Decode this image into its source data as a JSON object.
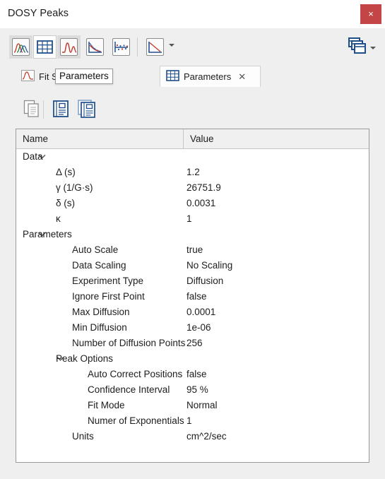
{
  "window": {
    "title": "DOSY Peaks",
    "close_label": "×"
  },
  "toolbar": {
    "buttons": [
      {
        "name": "multi-spectra-icon",
        "tooltip": "Spectra"
      },
      {
        "name": "table-icon",
        "tooltip": "Table"
      },
      {
        "name": "single-spectrum-icon",
        "tooltip": "Fit Spectra"
      },
      {
        "name": "decay-curves-icon",
        "tooltip": "Decay Curves"
      },
      {
        "name": "residuals-icon",
        "tooltip": "Residuals"
      },
      {
        "name": "diffusion-plot-icon",
        "tooltip": "Diffusion Plot"
      }
    ],
    "layout_icon": "stacked-windows-icon"
  },
  "tabs": [
    {
      "label": "Fit Spectra",
      "icon": "single-spectrum-icon",
      "close": "✕",
      "selected": false
    },
    {
      "label": "Parameters",
      "icon": "table-icon",
      "close": "✕",
      "selected": true
    }
  ],
  "tooltip": {
    "text": "Parameters"
  },
  "subtoolbar": {
    "buttons": [
      {
        "name": "copy-icon"
      },
      {
        "name": "report-icon"
      },
      {
        "name": "multi-report-icon"
      }
    ]
  },
  "table": {
    "columns": [
      "Name",
      "Value"
    ],
    "rows": [
      {
        "name": "Data",
        "value": "",
        "level": 0,
        "group": true
      },
      {
        "name": "Δ (s)",
        "value": "1.2",
        "level": 1,
        "group": false
      },
      {
        "name": "γ (1/G·s)",
        "value": "26751.9",
        "level": 1,
        "group": false
      },
      {
        "name": "δ (s)",
        "value": "0.0031",
        "level": 1,
        "group": false
      },
      {
        "name": "κ",
        "value": "1",
        "level": 1,
        "group": false
      },
      {
        "name": "Parameters",
        "value": "",
        "level": 0,
        "group": true
      },
      {
        "name": "Auto Scale",
        "value": "true",
        "level": 2,
        "group": false
      },
      {
        "name": "Data Scaling",
        "value": "No Scaling",
        "level": 2,
        "group": false
      },
      {
        "name": "Experiment Type",
        "value": "Diffusion",
        "level": 2,
        "group": false
      },
      {
        "name": "Ignore First Point",
        "value": "false",
        "level": 2,
        "group": false
      },
      {
        "name": "Max Diffusion",
        "value": "0.0001",
        "level": 2,
        "group": false
      },
      {
        "name": "Min Diffusion",
        "value": "1e-06",
        "level": 2,
        "group": false
      },
      {
        "name": "Number of Diffusion Points",
        "value": "256",
        "level": 2,
        "group": false
      },
      {
        "name": "Peak Options",
        "value": "",
        "level": 1,
        "group": true
      },
      {
        "name": "Auto Correct Positions",
        "value": "false",
        "level": 3,
        "group": false
      },
      {
        "name": "Confidence Interval",
        "value": "95 %",
        "level": 3,
        "group": false
      },
      {
        "name": "Fit Mode",
        "value": "Normal",
        "level": 3,
        "group": false
      },
      {
        "name": "Numer of Exponentials",
        "value": "1",
        "level": 3,
        "group": false
      },
      {
        "name": "Units",
        "value": "cm^2/sec",
        "level": 2,
        "group": false
      }
    ]
  },
  "colors": {
    "close_red": "#c44545",
    "window_bg": "#efefef",
    "panel_bg": "#ffffff",
    "accent_blue": "#1f4e8c"
  }
}
